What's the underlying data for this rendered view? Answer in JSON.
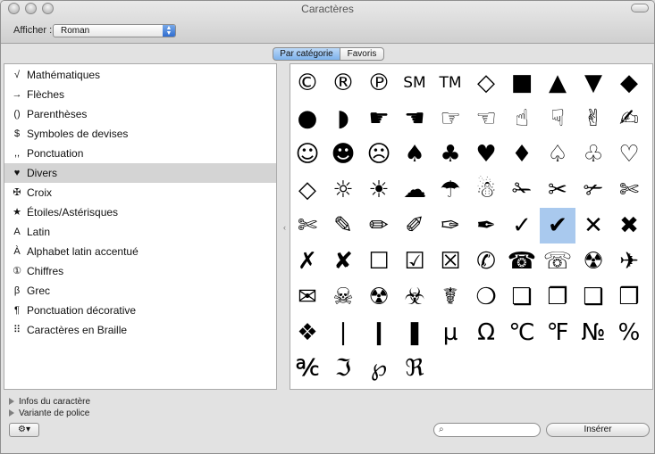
{
  "window": {
    "title": "Caractères"
  },
  "toolbar": {
    "show_label": "Afficher :",
    "show_value": "Roman"
  },
  "view_tabs": [
    "Par catégorie",
    "Favoris"
  ],
  "categories": [
    {
      "icon": "√",
      "label": "Mathématiques"
    },
    {
      "icon": "→",
      "label": "Flèches"
    },
    {
      "icon": "()",
      "label": "Parenthèses"
    },
    {
      "icon": "$",
      "label": "Symboles de devises"
    },
    {
      "icon": ",,",
      "label": "Ponctuation"
    },
    {
      "icon": "♥",
      "label": "Divers"
    },
    {
      "icon": "✠",
      "label": "Croix"
    },
    {
      "icon": "★",
      "label": "Étoiles/Astérisques"
    },
    {
      "icon": "A",
      "label": "Latin"
    },
    {
      "icon": "À",
      "label": "Alphabet latin accentué"
    },
    {
      "icon": "①",
      "label": "Chiffres"
    },
    {
      "icon": "β",
      "label": "Grec"
    },
    {
      "icon": "¶",
      "label": "Ponctuation décorative"
    },
    {
      "icon": "⠿",
      "label": "Caractères en Braille"
    }
  ],
  "selected_category": "Divers",
  "glyphs": [
    [
      "©",
      "®",
      "℗",
      "SM",
      "TM",
      "◇",
      "■",
      "▲",
      "▼",
      "◆"
    ],
    [
      "●",
      "◗",
      "☛",
      "☚",
      "☞",
      "☜",
      "☝",
      "☟",
      "✌",
      "✍"
    ],
    [
      "☺",
      "☻",
      "☹",
      "♠",
      "♣",
      "♥",
      "♦",
      "♤",
      "♧",
      "♡"
    ],
    [
      "◇",
      "☼",
      "☀",
      "☁",
      "☂",
      "☃",
      "✁",
      "✂",
      "✃",
      "✄"
    ],
    [
      "✄",
      "✎",
      "✏",
      "✐",
      "✑",
      "✒",
      "✓",
      "✔",
      "✕",
      "✖"
    ],
    [
      "✗",
      "✘",
      "☐",
      "☑",
      "☒",
      "✆",
      "☎",
      "☏",
      "☢",
      "✈"
    ],
    [
      "✉",
      "☠",
      "☢",
      "☣",
      "☤",
      "❍",
      "❏",
      "❐",
      "❑",
      "❒"
    ],
    [
      "❖",
      "❘",
      "❙",
      "❚",
      "µ",
      "Ω",
      "℃",
      "℉",
      "№",
      "%"
    ],
    [
      "℀",
      "ℑ",
      "℘",
      "ℜ"
    ]
  ],
  "selected_glyph": "✔",
  "disclosures": [
    "Infos du caractère",
    "Variante de police"
  ],
  "search": {
    "placeholder": ""
  },
  "insert_label": "Insérer"
}
